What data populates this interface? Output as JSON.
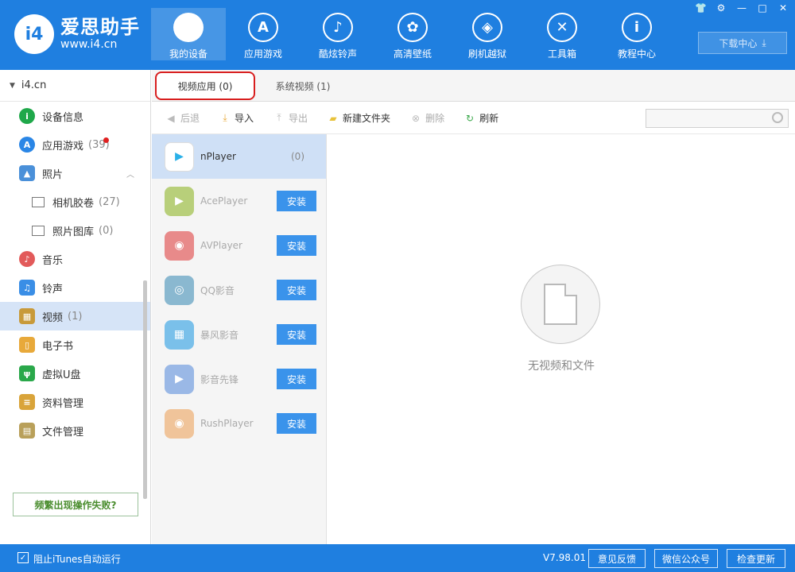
{
  "app": {
    "logo_badge": "i4",
    "logo_title": "爱思助手",
    "logo_url": "www.i4.cn"
  },
  "nav": [
    {
      "label": "我的设备",
      "icon": "apple-icon",
      "glyph": "",
      "active": true
    },
    {
      "label": "应用游戏",
      "icon": "appstore-icon",
      "glyph": "A"
    },
    {
      "label": "酷炫铃声",
      "icon": "bell-icon",
      "glyph": "♪"
    },
    {
      "label": "高清壁纸",
      "icon": "flower-icon",
      "glyph": "✿"
    },
    {
      "label": "刷机越狱",
      "icon": "box-icon",
      "glyph": "◈"
    },
    {
      "label": "工具箱",
      "icon": "tools-icon",
      "glyph": "✕"
    },
    {
      "label": "教程中心",
      "icon": "info-icon",
      "glyph": "i"
    }
  ],
  "window_controls": [
    "👕",
    "⚙",
    "—",
    "□",
    "✕"
  ],
  "download_center": "下载中心",
  "sidebar": {
    "device": "i4.cn",
    "items": [
      {
        "label": "设备信息",
        "icon": "info-circle-icon",
        "color": "#1fa84a"
      },
      {
        "label": "应用游戏",
        "count": "(39)",
        "icon": "appstore-icon",
        "color": "#2a86e6"
      },
      {
        "label": "照片",
        "icon": "photo-icon",
        "color": "#4a90d9"
      },
      {
        "label": "相机胶卷",
        "count": "(27)"
      },
      {
        "label": "照片图库",
        "count": "(0)"
      },
      {
        "label": "音乐",
        "icon": "music-icon",
        "color": "#e25a5a"
      },
      {
        "label": "铃声",
        "icon": "bell-icon",
        "color": "#3a8ee6"
      },
      {
        "label": "视频",
        "count": "(1)",
        "icon": "film-icon",
        "color": "#c89a3a"
      },
      {
        "label": "电子书",
        "icon": "book-icon",
        "color": "#e8a93a"
      },
      {
        "label": "虚拟U盘",
        "icon": "usb-icon",
        "color": "#2aa84a"
      },
      {
        "label": "资料管理",
        "icon": "contacts-icon",
        "color": "#d9a43a"
      },
      {
        "label": "文件管理",
        "icon": "file-icon",
        "color": "#b9a05a"
      }
    ],
    "fail_button": "频繁出现操作失败?"
  },
  "tabs": [
    {
      "label": "视频应用 (0)",
      "active": true
    },
    {
      "label": "系统视频 (1)"
    }
  ],
  "toolbar": {
    "back": "后退",
    "import": "导入",
    "export": "导出",
    "new_folder": "新建文件夹",
    "delete": "删除",
    "refresh": "刷新"
  },
  "apps": [
    {
      "name": "nPlayer",
      "count": "(0)",
      "color": "#ffffff",
      "selected": true
    },
    {
      "name": "AcePlayer",
      "install": "安装",
      "color": "#b8cf7a"
    },
    {
      "name": "AVPlayer",
      "install": "安装",
      "color": "#e88a8a"
    },
    {
      "name": "QQ影音",
      "install": "安装",
      "color": "#8ab8d0"
    },
    {
      "name": "暴风影音",
      "install": "安装",
      "color": "#7ac0ea"
    },
    {
      "name": "影音先锋",
      "install": "安装",
      "color": "#9ab8e6"
    },
    {
      "name": "RushPlayer",
      "install": "安装",
      "color": "#f0c49a"
    }
  ],
  "empty_text": "无视频和文件",
  "footer": {
    "itunes_label": "阻止iTunes自动运行",
    "version": "V7.98.01",
    "feedback": "意见反馈",
    "wechat": "微信公众号",
    "update": "检查更新"
  }
}
